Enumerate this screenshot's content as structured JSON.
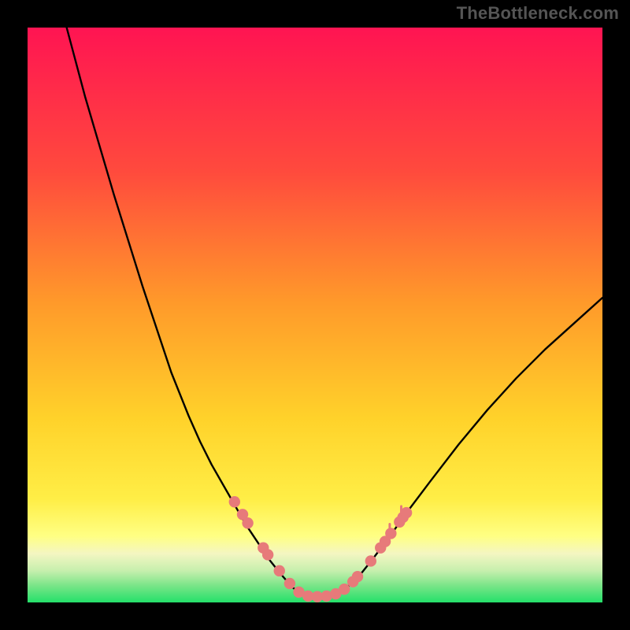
{
  "watermark": "TheBottleneck.com",
  "colors": {
    "bg_black": "#000000",
    "curve": "#000000",
    "dot_fill": "#e77a7a",
    "dot_stroke": "#d86a6a",
    "grad_top": "#ff1452",
    "grad_mid1": "#ff8b2a",
    "grad_mid2": "#ffe12a",
    "grad_yellow": "#ffff70",
    "grad_pale": "#f5f7c0",
    "grad_green_light": "#9fe88b",
    "grad_green": "#2ee76b"
  },
  "chart_data": {
    "type": "line",
    "title": "",
    "xlabel": "",
    "ylabel": "",
    "x_range": [
      0,
      100
    ],
    "y_range": [
      0,
      100
    ],
    "note": "Values are estimated from pixel positions; axes had no tick labels.",
    "series": [
      {
        "name": "left-curve",
        "x": [
          6.8,
          10,
          15,
          20,
          25,
          28,
          30,
          32,
          34,
          36,
          38,
          40,
          42,
          44,
          46,
          47.5
        ],
        "y": [
          100,
          88,
          71,
          55,
          40,
          32.5,
          28,
          24,
          20.5,
          17,
          13.5,
          10.5,
          7.5,
          5,
          2.7,
          1.5
        ]
      },
      {
        "name": "valley-floor",
        "x": [
          47.5,
          49,
          51,
          53,
          54.5
        ],
        "y": [
          1.5,
          1.0,
          1.0,
          1.2,
          1.8
        ]
      },
      {
        "name": "right-curve",
        "x": [
          54.5,
          56,
          58,
          60,
          63,
          66,
          70,
          75,
          80,
          85,
          90,
          95,
          100
        ],
        "y": [
          1.8,
          3.0,
          5.0,
          7.5,
          11.5,
          15.7,
          21.0,
          27.5,
          33.5,
          39.0,
          44.0,
          48.5,
          53.0
        ]
      }
    ],
    "markers": {
      "name": "highlighted-points",
      "points": [
        {
          "x": 36.0,
          "y": 17.5
        },
        {
          "x": 37.4,
          "y": 15.3
        },
        {
          "x": 38.3,
          "y": 13.8
        },
        {
          "x": 41.0,
          "y": 9.5
        },
        {
          "x": 41.8,
          "y": 8.3
        },
        {
          "x": 43.8,
          "y": 5.5
        },
        {
          "x": 45.6,
          "y": 3.3
        },
        {
          "x": 47.2,
          "y": 1.8
        },
        {
          "x": 48.8,
          "y": 1.1
        },
        {
          "x": 50.4,
          "y": 1.0
        },
        {
          "x": 52.0,
          "y": 1.1
        },
        {
          "x": 53.6,
          "y": 1.5
        },
        {
          "x": 55.1,
          "y": 2.3
        },
        {
          "x": 56.6,
          "y": 3.6
        },
        {
          "x": 57.4,
          "y": 4.5
        },
        {
          "x": 59.7,
          "y": 7.2
        },
        {
          "x": 61.4,
          "y": 9.5
        },
        {
          "x": 62.2,
          "y": 10.6
        },
        {
          "x": 63.2,
          "y": 12.0
        },
        {
          "x": 64.7,
          "y": 14.0
        },
        {
          "x": 65.3,
          "y": 14.8
        },
        {
          "x": 65.9,
          "y": 15.6
        }
      ]
    },
    "gradient_bands_y": [
      {
        "name": "red",
        "from": 100,
        "to": 42
      },
      {
        "name": "orange",
        "from": 42,
        "to": 28
      },
      {
        "name": "yellow",
        "from": 28,
        "to": 13
      },
      {
        "name": "pale-yellow",
        "from": 13,
        "to": 9.8
      },
      {
        "name": "cream",
        "from": 9.8,
        "to": 5.5
      },
      {
        "name": "light-green",
        "from": 5.5,
        "to": 2.6
      },
      {
        "name": "green",
        "from": 2.6,
        "to": 0
      }
    ]
  }
}
